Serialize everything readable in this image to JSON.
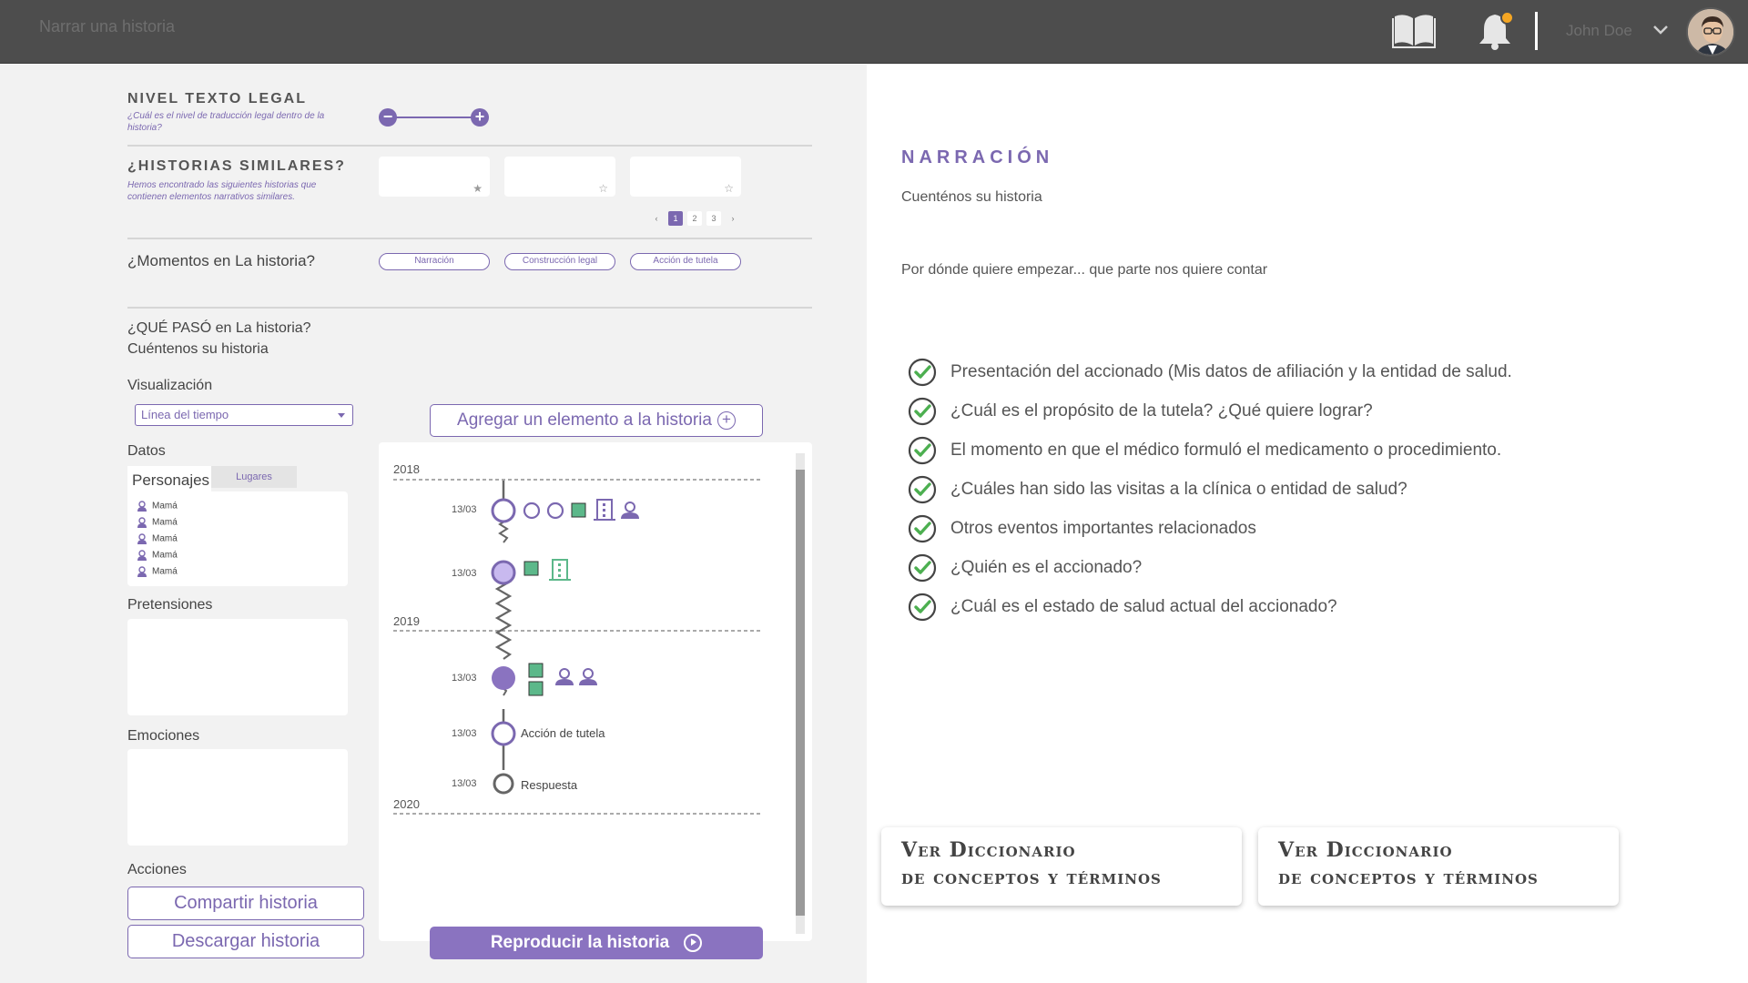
{
  "topbar": {
    "app_title": "Narrar una historia",
    "user_name": "John Doe",
    "icons": [
      "book-icon",
      "bell-icon",
      "chevron-down-icon",
      "avatar"
    ],
    "notification_dot_color": "#f5a623",
    "bar_color": "#4d4d4d"
  },
  "legal_level": {
    "title": "NIVEL TEXTO LEGAL",
    "subtitle": "¿Cuál es el nivel de traducción legal dentro de la historia?"
  },
  "similar": {
    "title": "¿HISTORIAS SIMILARES?",
    "subtitle": "Hemos encontrado las siguientes historias que contienen elementos narrativos similares.",
    "pages": [
      "1",
      "2",
      "3"
    ],
    "active_page": "1"
  },
  "moments": {
    "label": "¿Momentos en La historia?",
    "pills": [
      "Narración",
      "Construcción legal",
      "Acción de tutela"
    ]
  },
  "what_happened": {
    "line1": "¿QUÉ PASÓ en La historia?",
    "line2": "Cuéntenos su historia"
  },
  "visualization": {
    "label": "Visualización",
    "selected": "Línea del tiempo"
  },
  "data_section": {
    "label": "Datos",
    "tab_characters": "Personajes",
    "tab_places": "Lugares",
    "characters": [
      "Mamá",
      "Mamá",
      "Mamá",
      "Mamá",
      "Mamá"
    ]
  },
  "claims_label": "Pretensiones",
  "emotions_label": "Emociones",
  "actions": {
    "label": "Acciones",
    "share": "Compartir historia",
    "download": "Descargar historia"
  },
  "add_element_label": "Agregar un elemento a la historia",
  "play_label": "Reproducir la historia",
  "timeline": {
    "years": [
      "2018",
      "2019",
      "2020"
    ],
    "events": [
      {
        "date": "13/03",
        "label": ""
      },
      {
        "date": "13/03",
        "label": ""
      },
      {
        "date": "13/03",
        "label": ""
      },
      {
        "date": "13/03",
        "label": "Acción de tutela"
      },
      {
        "date": "13/03",
        "label": "Respuesta"
      }
    ]
  },
  "narration": {
    "title": "NARRACIÓN",
    "subtitle": "Cuenténos su historia",
    "prompt": "Por dónde quiere empezar... que parte nos quiere contar",
    "checklist": [
      "Presentación del accionado (Mis datos de afiliación y la entidad de salud.",
      "¿Cuál es el propósito de la tutela? ¿Qué quiere lograr?",
      "El momento en que el médico formuló el medicamento o procedimiento.",
      "¿Cuáles han sido las visitas a la clínica o entidad de salud?",
      "Otros eventos importantes relacionados",
      "¿Quién es el accionado?",
      "¿Cuál es el estado de salud actual del accionado?"
    ],
    "dictionary_cards": [
      {
        "line1": "Ver Diccionario",
        "line2": "de conceptos y términos"
      },
      {
        "line1": "Ver Diccionario",
        "line2": "de conceptos y términos"
      }
    ]
  },
  "colors": {
    "accent": "#7b68b0",
    "check_green": "#4caf50",
    "green_item": "#5cb88a"
  }
}
